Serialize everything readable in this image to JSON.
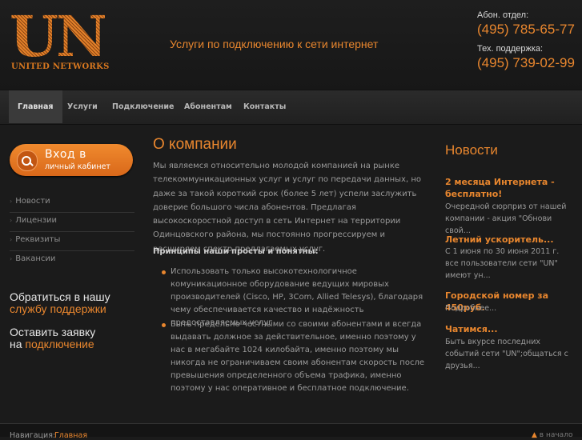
{
  "header": {
    "logo_text": "UN",
    "logo_sub": "UNITED NETWORKS",
    "tagline": "Услуги по подключению к сети интернет",
    "sales_label": "Абон. отдел:",
    "sales_phone": "(495) 785-65-77",
    "support_label": "Тех. поддержка:",
    "support_phone": "(495) 739-02-99"
  },
  "nav": {
    "items": [
      {
        "label": "Главная",
        "active": true
      },
      {
        "label": "Услуги"
      },
      {
        "label": "Подключение"
      },
      {
        "label": "Абонентам"
      },
      {
        "label": "Контакты"
      }
    ]
  },
  "sidebar": {
    "login_title": "Вход в",
    "login_sub": "личный кабинет",
    "links": [
      "Новости",
      "Лицензии",
      "Реквизиты",
      "Вакансии"
    ],
    "support_cta_line1": "Обратиться в нашу",
    "support_cta_line2": "службу поддержки",
    "order_cta_line1": "Оставить заявку",
    "order_cta_line2_prefix": "на",
    "order_cta_line2_link": "подключение"
  },
  "main": {
    "title": "О компании",
    "paragraph": "Мы являемся относительно молодой компанией на рынке телекоммуникационных услуг и услуг по передачи данных, но даже за такой короткий срок (более 5 лет) успели заслужить доверие большого числа абонентов. Предлагая высокоскоростной доступ в сеть Интернет на территории Одинцовского района, мы постоянно прогрессируем и расширяем спектр предлагаемых услуг.",
    "principles_heading": "Принципы наши просты и понятны:",
    "bullets": [
      "Использовать только высокотехнологичное комуникационное оборудование ведущих мировых производителей (Cisco, HP, 3Com, Allied Telesys), благодаря чему обеспечивается качество и надёжность предоставляемых услуг.",
      "Быть предельно честными со своими абонентами и всегда выдавать должное за действительное, именно поэтому у нас в мегабайте 1024 килобайта, именно поэтому мы никогда не ограничиваем своим абонентам скорость после превышения определенного объема трафика, именно поэтому у нас оперативное и бесплатное подключение."
    ]
  },
  "news": {
    "title": "Новости",
    "items": [
      {
        "head": "2 месяца Интернета - бесплатно!",
        "text": "Очередной сюрприз от нашей компании - акция \"Обнови свой..."
      },
      {
        "head": "Летний ускоритель...",
        "text": "С 1 июня по 30 июня 2011 г. все пользователи сети \"UN\" имеют ун..."
      },
      {
        "head": "Городской номер за 450руб.",
        "text": "Подробнее..."
      },
      {
        "head": "Чатимся...",
        "text": "Быть вкурсе последних событий сети \"UN\";общаться с друзья..."
      }
    ]
  },
  "footer": {
    "crumb_label": "Навигация:",
    "crumb_link": "Главная",
    "to_top": "в начало"
  }
}
